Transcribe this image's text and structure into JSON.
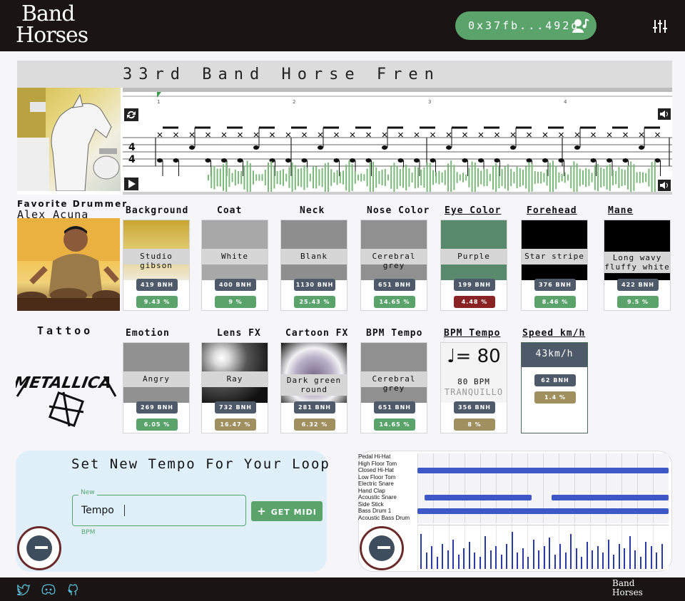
{
  "header": {
    "logo_line1": "Band",
    "logo_line2": "Horses",
    "wallet": "0x37fb...492d",
    "wallet_icon": "user-music-icon",
    "settings_icon": "sliders-icon"
  },
  "song": {
    "title": "33rd Band Horse Fren",
    "measures": [
      "1",
      "2",
      "3",
      "4"
    ],
    "loop_icon": "loop-icon",
    "play_icon": "play-icon",
    "volume_icon": "volume-icon"
  },
  "drummer": {
    "label": "Favorite Drummer",
    "name": "Alex Acuna"
  },
  "tattoo": {
    "label": "Tattoo",
    "logo_text": "METALLICA"
  },
  "traits_row1": [
    {
      "title": "Background",
      "value": "Studio gibson",
      "bnh": "419 BNH",
      "pct": "9.43 %",
      "pct_color": "#5aa46c"
    },
    {
      "title": "Coat",
      "value": "White",
      "bnh": "400 BNH",
      "pct": "9 %",
      "pct_color": "#5aa46c"
    },
    {
      "title": "Neck",
      "value": "Blank",
      "bnh": "1130 BNH",
      "pct": "25.43 %",
      "pct_color": "#5aa46c"
    },
    {
      "title": "Nose Color",
      "value": "Cerebral grey",
      "bnh": "651 BNH",
      "pct": "14.65 %",
      "pct_color": "#5aa46c"
    },
    {
      "title": "Eye Color",
      "value": "Purple",
      "bnh": "199 BNH",
      "pct": "4.48 %",
      "pct_color": "#8a2323"
    },
    {
      "title": "Forehead",
      "value": "Star stripe",
      "bnh": "376 BNH",
      "pct": "8.46 %",
      "pct_color": "#5aa46c"
    },
    {
      "title": "Mane",
      "value": "Long wavy fluffy white",
      "bnh": "422 BNH",
      "pct": "9.5 %",
      "pct_color": "#5aa46c"
    }
  ],
  "traits_row2": [
    {
      "title": "Emotion",
      "value": "Angry",
      "bnh": "269 BNH",
      "pct": "6.05 %",
      "pct_color": "#5aa46c"
    },
    {
      "title": "Lens FX",
      "value": "Ray",
      "bnh": "732 BNH",
      "pct": "16.47 %",
      "pct_color": "#a09060"
    },
    {
      "title": "Cartoon FX",
      "value": "Dark green round",
      "bnh": "281 BNH",
      "pct": "6.32 %",
      "pct_color": "#a09060"
    },
    {
      "title": "BPM Tempo",
      "value": "Cerebral grey",
      "bnh": "651 BNH",
      "pct": "14.65 %",
      "pct_color": "#5aa46c"
    },
    {
      "title": "BPM Tempo",
      "value": "80 BPM",
      "sub": "TRANQUILLO",
      "thumb_text": "♩= 80",
      "bnh": "356 BNH",
      "pct": "8 %",
      "pct_color": "#a09060"
    },
    {
      "title": "Speed km/h",
      "value": "43km/h",
      "bnh": "62 BNH",
      "pct": "1.4 %",
      "pct_color": "#a09060"
    }
  ],
  "tempo_form": {
    "title": "Set New Tempo For Your Loop",
    "field_label": "New",
    "field_value": "Tempo",
    "helper": "BPM",
    "button": "GET MIDI",
    "button_icon": "plus-icon"
  },
  "piano_roll": {
    "instruments": [
      "Pedal Hi-Hat",
      "High Floor Tom",
      "Closed Hi-Hat",
      "Low Floor Tom",
      "Electric Snare",
      "Hand Clap",
      "Acoustic Snare",
      "Side Stick",
      "Bass Drum 1",
      "Acoustic Bass Drum"
    ],
    "velocity_values": [
      0.85,
      0.4,
      0.55,
      0.3,
      0.6,
      0.45,
      0.7,
      0.35,
      0.5,
      0.65,
      0.4,
      0.3,
      0.8,
      0.45,
      0.55,
      0.35,
      0.6,
      0.9,
      0.4,
      0.5,
      0.3,
      0.7,
      0.45,
      0.55,
      0.75,
      0.35,
      0.6,
      0.4,
      0.85,
      0.5,
      0.3,
      0.65,
      0.45,
      0.55,
      0.4,
      0.7,
      0.35,
      0.6,
      0.5,
      0.8,
      0.45,
      0.3,
      0.65,
      0.55,
      0.4,
      0.6
    ]
  },
  "footer": {
    "icons": [
      "twitter-icon",
      "discord-icon",
      "github-icon"
    ],
    "logo_line1": "Band",
    "logo_line2": "Horses"
  }
}
